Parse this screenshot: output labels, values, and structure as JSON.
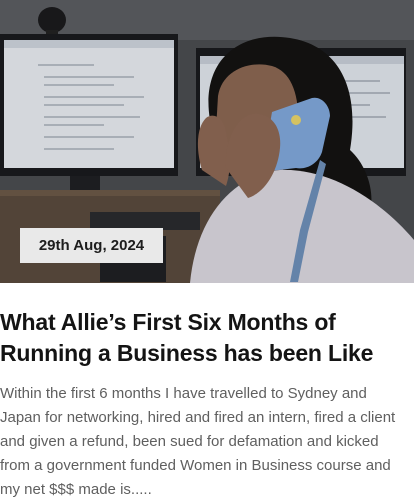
{
  "post": {
    "date": "29th Aug, 2024",
    "title": "What Allie’s First Six Months of Running a Business has been Like",
    "excerpt": "Within the first 6 months I have travelled to Sydney and Japan for networking, hired and fired an intern, fired a client and given a refund, been sued for defamation and kicked from a government funded Women in Business course and my net $$$ made is....."
  },
  "colors": {
    "title": "#141414",
    "excerpt": "#5f5f5f",
    "badge_bg": "#e9e9e9"
  }
}
